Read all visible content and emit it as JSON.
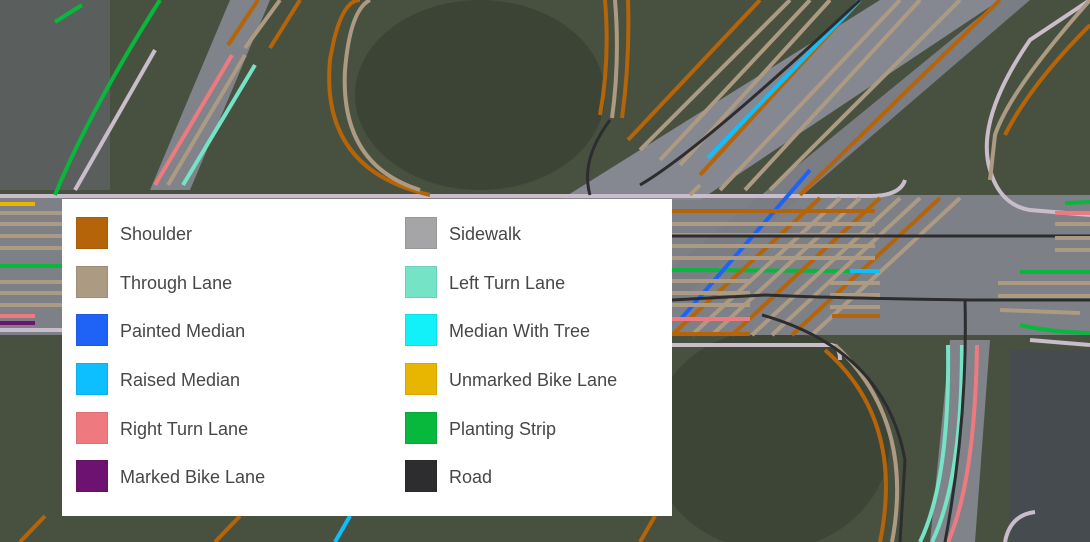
{
  "map": {
    "type": "aerial-imagery-with-lane-annotations",
    "colors": {
      "grass_dark": "#3f4a36",
      "grass_mid": "#5c6650",
      "pavement": "#8a8e94",
      "pavement_dark": "#55595f"
    }
  },
  "legend": {
    "left_column": [
      {
        "label": "Shoulder",
        "color": "#b5640a"
      },
      {
        "label": "Through Lane",
        "color": "#ad9a82"
      },
      {
        "label": "Painted Median",
        "color": "#1e63f5"
      },
      {
        "label": "Raised Median",
        "color": "#0dbfff"
      },
      {
        "label": "Right Turn Lane",
        "color": "#ee7a80"
      },
      {
        "label": "Marked Bike Lane",
        "color": "#6d136f"
      }
    ],
    "right_column": [
      {
        "label": "Sidewalk",
        "color": "#a5a5a7"
      },
      {
        "label": "Left Turn Lane",
        "color": "#74e3c6"
      },
      {
        "label": "Median With Tree",
        "color": "#12f1fa"
      },
      {
        "label": "Unmarked Bike Lane",
        "color": "#e8b500"
      },
      {
        "label": "Planting Strip",
        "color": "#07b83c"
      },
      {
        "label": "Road",
        "color": "#2d2d2f"
      }
    ]
  }
}
